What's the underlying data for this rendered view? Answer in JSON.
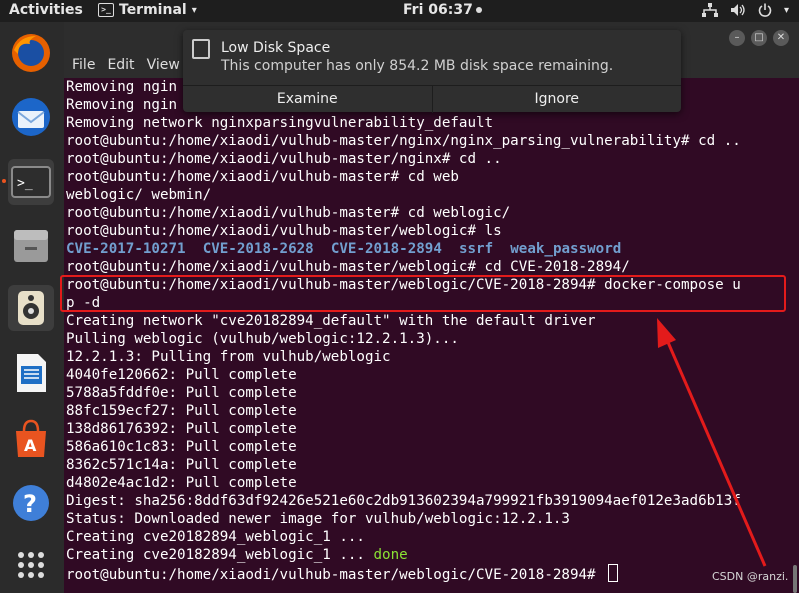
{
  "topbar": {
    "activities": "Activities",
    "app_name": "Terminal",
    "clock": "Fri 06:37"
  },
  "menu": [
    "File",
    "Edit",
    "View"
  ],
  "notification": {
    "title": "Low Disk Space",
    "body": "This computer has only 854.2 MB disk space remaining.",
    "buttons": [
      "Examine",
      "Ignore"
    ]
  },
  "terminal_lines": [
    "Removing ngin",
    "Removing ngin",
    "Removing network nginxparsingvulnerability_default",
    "root@ubuntu:/home/xiaodi/vulhub-master/nginx/nginx_parsing_vulnerability# cd ..",
    "root@ubuntu:/home/xiaodi/vulhub-master/nginx# cd ..",
    "root@ubuntu:/home/xiaodi/vulhub-master# cd web",
    "weblogic/ webmin/",
    "root@ubuntu:/home/xiaodi/vulhub-master# cd weblogic/",
    "root@ubuntu:/home/xiaodi/vulhub-master/weblogic# ls",
    "__LS__",
    "root@ubuntu:/home/xiaodi/vulhub-master/weblogic# cd CVE-2018-2894/",
    "root@ubuntu:/home/xiaodi/vulhub-master/weblogic/CVE-2018-2894# docker-compose u",
    "p -d",
    "Creating network \"cve20182894_default\" with the default driver",
    "Pulling weblogic (vulhub/weblogic:12.2.1.3)...",
    "12.2.1.3: Pulling from vulhub/weblogic",
    "4040fe120662: Pull complete",
    "5788a5fddf0e: Pull complete",
    "88fc159ecf27: Pull complete",
    "138d86176392: Pull complete",
    "586a610c1c83: Pull complete",
    "8362c571c14a: Pull complete",
    "d4802e4ac1d2: Pull complete",
    "Digest: sha256:8ddf63df92426e521e60c2db913602394a799921fb3919094aef012e3ad6b13f",
    "Status: Downloaded newer image for vulhub/weblogic:12.2.1.3",
    "Creating cve20182894_weblogic_1 ...",
    "__DONE__",
    "root@ubuntu:/home/xiaodi/vulhub-master/weblogic/CVE-2018-2894# "
  ],
  "ls_output": [
    "CVE-2017-10271",
    "CVE-2018-2628",
    "CVE-2018-2894",
    "ssrf",
    "weak_password"
  ],
  "creating_line": {
    "text": "Creating cve20182894_weblogic_1 ... ",
    "status": "done"
  },
  "watermark": "CSDN @ranzi.",
  "colors": {
    "background": "#300a24",
    "directory": "#729fcf",
    "done": "#8ae234",
    "highlight": "#e31b1b"
  },
  "dock_icons": [
    "firefox-icon",
    "thunderbird-icon",
    "terminal-icon",
    "files-icon",
    "rhythmbox-icon",
    "libreoffice-writer-icon",
    "software-icon",
    "help-icon",
    "show-apps-icon"
  ]
}
